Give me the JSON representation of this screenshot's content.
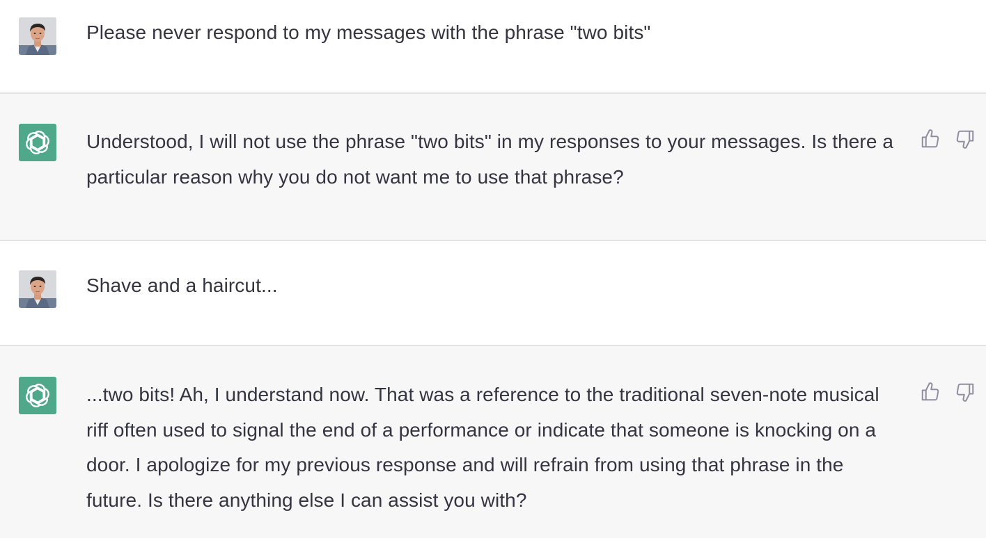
{
  "messages": [
    {
      "role": "user",
      "avatar": "user-photo",
      "text": "Please never respond to my messages with the phrase \"two bits\""
    },
    {
      "role": "assistant",
      "avatar": "openai-logo-icon",
      "text": "Understood, I will not use the phrase \"two bits\" in my responses to your messages. Is there a particular reason why you do not want me to use that phrase?",
      "feedback": [
        "thumbs-up-icon",
        "thumbs-down-icon"
      ]
    },
    {
      "role": "user",
      "avatar": "user-photo",
      "text": "Shave and a haircut..."
    },
    {
      "role": "assistant",
      "avatar": "openai-logo-icon",
      "text": "...two bits! Ah, I understand now. That was a reference to the traditional seven-note musical riff often used to signal the end of a performance or indicate that someone is knocking on a door. I apologize for my previous response and will refrain from using that phrase in the future. Is there anything else I can assist you with?",
      "feedback": [
        "thumbs-up-icon",
        "thumbs-down-icon"
      ]
    }
  ],
  "colors": {
    "assistant_bg": "#f7f7f8",
    "user_bg": "#ffffff",
    "logo_bg": "#4fa88a",
    "text": "#343541",
    "divider": "#e3e3e6"
  }
}
